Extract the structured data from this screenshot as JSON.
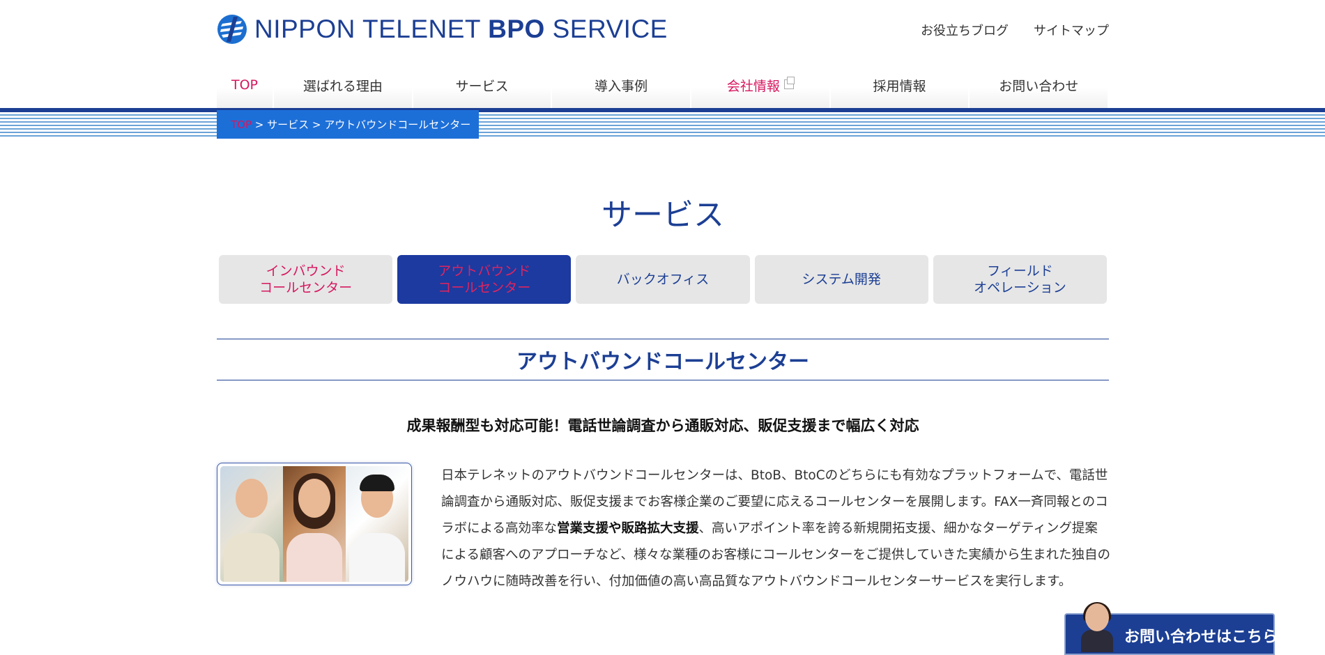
{
  "header": {
    "logo_text_1": "NIPPON TELENET",
    "logo_text_2": "BPO",
    "logo_text_3": "SERVICE",
    "util_links": [
      "お役立ちブログ",
      "サイトマップ"
    ]
  },
  "gnav": {
    "items": [
      {
        "label": "TOP"
      },
      {
        "label": "選ばれる理由"
      },
      {
        "label": "サービス"
      },
      {
        "label": "導入事例"
      },
      {
        "label": "会社情報"
      },
      {
        "label": "採用情報"
      },
      {
        "label": "お問い合わせ"
      }
    ]
  },
  "breadcrumb": {
    "top": "TOP",
    "sep": " > ",
    "level2": "サービス",
    "current": "アウトバウンドコールセンター"
  },
  "page_title": "サービス",
  "category_tabs": [
    {
      "line1": "インバウンド",
      "line2": "コールセンター"
    },
    {
      "line1": "アウトバウンド",
      "line2": "コールセンター"
    },
    {
      "line1": "バックオフィス",
      "line2": ""
    },
    {
      "line1": "システム開発",
      "line2": ""
    },
    {
      "line1": "フィールド",
      "line2": "オペレーション"
    }
  ],
  "section_heading": "アウトバウンドコールセンター",
  "catch_copy": "成果報酬型も対応可能！電話世論調査から通販対応、販促支援まで幅広く対応",
  "description": {
    "part1": "日本テレネットのアウトバウンドコールセンターは、BtoB、BtoCのどちらにも有効なプラットフォームで、電話世論調査から通販対応、販促支援までお客様企業のご要望に応えるコールセンターを展開します。FAX一斉同報とのコラボによる高効率な",
    "bold": "営業支援や販路拡大支援",
    "part2": "、高いアポイント率を誇る新規開拓支援、細かなターゲティング提案による顧客へのアプローチなど、様々な業種のお客様にコールセンターをご提供していきた実績から生まれた独自のノウハウに随時改善を行い、付加価値の高い高品質なアウトバウンドコールセンターサービスを実行します。"
  },
  "contact_banner": {
    "label": "お問い合わせはこちら"
  },
  "colors": {
    "brand": "#1c3f94",
    "accent_pink": "#d6175f",
    "breadcrumb_blue": "#1d6fd8"
  }
}
